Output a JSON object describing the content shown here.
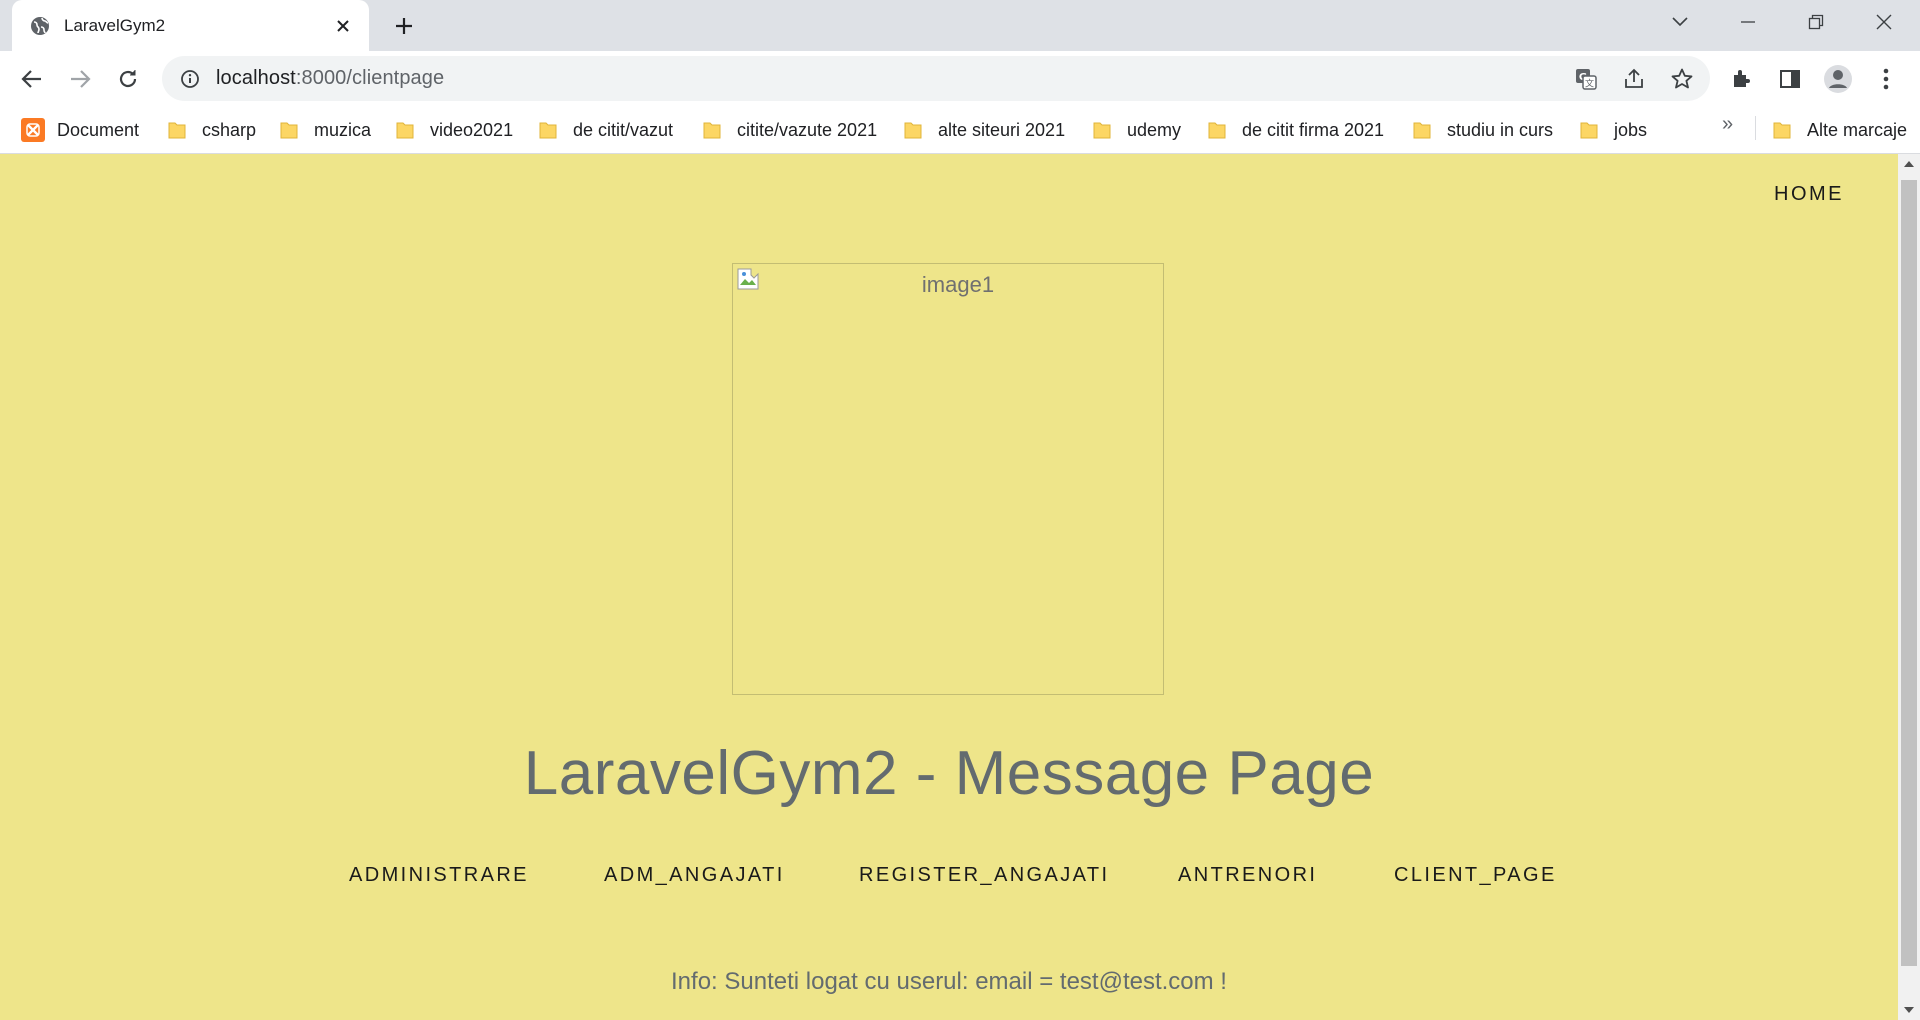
{
  "browser": {
    "tab": {
      "title": "LaravelGym2"
    },
    "url": {
      "host": "localhost",
      "path": ":8000/clientpage"
    },
    "bookmarks": [
      {
        "label": "Document",
        "icon": "xampp-icon"
      },
      {
        "label": "csharp",
        "icon": "folder-icon"
      },
      {
        "label": "muzica",
        "icon": "folder-icon"
      },
      {
        "label": "video2021",
        "icon": "folder-icon"
      },
      {
        "label": "de citit/vazut",
        "icon": "folder-icon"
      },
      {
        "label": "citite/vazute 2021",
        "icon": "folder-icon"
      },
      {
        "label": "alte siteuri 2021",
        "icon": "folder-icon"
      },
      {
        "label": "udemy",
        "icon": "folder-icon"
      },
      {
        "label": "de citit firma 2021",
        "icon": "folder-icon"
      },
      {
        "label": "studiu in curs",
        "icon": "folder-icon"
      },
      {
        "label": "jobs",
        "icon": "folder-icon"
      }
    ],
    "bookmarks_overflow": "»",
    "other_bookmarks": "Alte marcaje"
  },
  "page": {
    "home_link": "HOME",
    "image_alt": "image1",
    "heading": "LaravelGym2 - Message Page",
    "nav": [
      {
        "label": "ADMINISTRARE"
      },
      {
        "label": "ADM_ANGAJATI"
      },
      {
        "label": "REGISTER_ANGAJATI"
      },
      {
        "label": "ANTRENORI"
      },
      {
        "label": "CLIENT_PAGE"
      }
    ],
    "info": "Info: Sunteti logat cu userul: email = test@test.com !"
  },
  "colors": {
    "page_background": "#eee58a",
    "heading_text": "#636b6f",
    "folder": "#fcd664"
  }
}
